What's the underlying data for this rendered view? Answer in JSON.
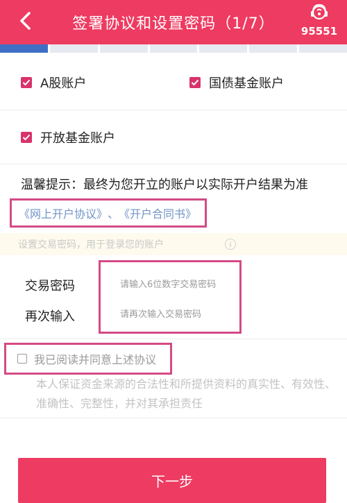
{
  "header": {
    "title": "签署协议和设置密码（1/7）",
    "service_number": "95551",
    "color": "#ee3b61"
  },
  "progress": {
    "total_steps": 7,
    "current_step": 1,
    "active_color": "#3f6fc4"
  },
  "accounts": [
    {
      "label": "A股账户",
      "checked": true
    },
    {
      "label": "国债基金账户",
      "checked": true
    },
    {
      "label": "开放基金账户",
      "checked": true
    }
  ],
  "tip": "温馨提示：最终为您开立的账户以实际开户结果为准",
  "agreements": {
    "link1": "《网上开户协议》",
    "separator": "、",
    "link2": "《开户合同书》"
  },
  "notice": "设置交易密码，用于登录您的账户",
  "password": {
    "label": "交易密码",
    "placeholder": "请输入6位数字交易密码",
    "confirm_label": "再次输入",
    "confirm_placeholder": "请再次输入交易密码"
  },
  "agree": {
    "label": "我已阅读并同意上述协议",
    "checked": false
  },
  "disclaimer": "本人保证资金来源的合法性和所提供资料的真实性、有效性、准确性、完整性，并对其承担责任",
  "next_button": "下一步"
}
